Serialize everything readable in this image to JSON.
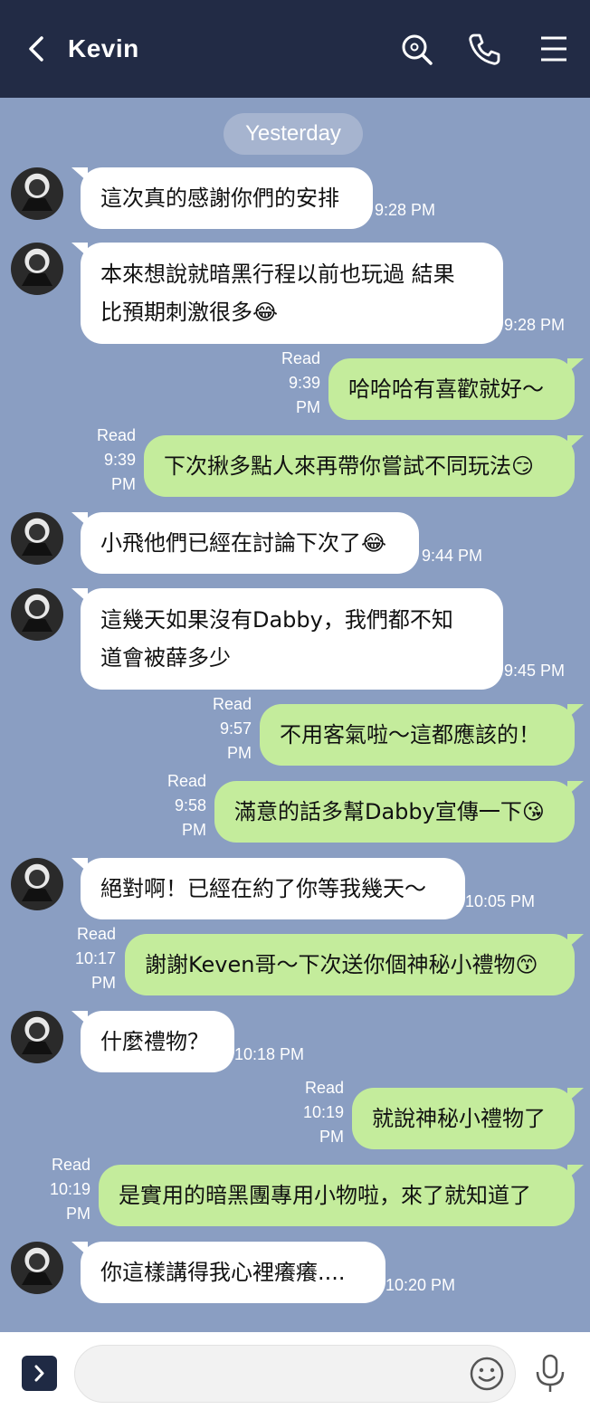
{
  "header": {
    "title": "Kevin"
  },
  "date_separator": "Yesterday",
  "messages": [
    {
      "dir": "in",
      "text": "這次真的感謝你們的安排",
      "time": "9:28 PM"
    },
    {
      "dir": "in",
      "text": "本來想說就暗黑行程以前也玩過 結果\n比預期刺激很多😂",
      "time": "9:28 PM"
    },
    {
      "dir": "out",
      "text": "哈哈哈有喜歡就好～",
      "read": "Read",
      "time_a": "9:39",
      "time_b": "PM"
    },
    {
      "dir": "out",
      "text": "下次揪多點人來再帶你嘗試不同玩法😏",
      "read": "Read",
      "time_a": "9:39",
      "time_b": "PM"
    },
    {
      "dir": "in",
      "text": "小飛他們已經在討論下次了😂",
      "time": "9:44 PM"
    },
    {
      "dir": "in",
      "text": "這幾天如果沒有Dabby，我們都不知\n道會被薛多少",
      "time": "9:45 PM"
    },
    {
      "dir": "out",
      "text": "不用客氣啦～這都應該的！",
      "read": "Read",
      "time_a": "9:57",
      "time_b": "PM"
    },
    {
      "dir": "out",
      "text": "滿意的話多幫Dabby宣傳一下😘",
      "read": "Read",
      "time_a": "9:58",
      "time_b": "PM"
    },
    {
      "dir": "in",
      "text": "絕對啊！已經在約了你等我幾天～",
      "time": "10:05 PM"
    },
    {
      "dir": "out",
      "text": "謝謝Keven哥～下次送你個神秘小禮物😙",
      "read": "Read",
      "time_a": "10:17",
      "time_b": "PM"
    },
    {
      "dir": "in",
      "text": "什麼禮物？",
      "time": "10:18 PM"
    },
    {
      "dir": "out",
      "text": "就說神秘小禮物了",
      "read": "Read",
      "time_a": "10:19",
      "time_b": "PM"
    },
    {
      "dir": "out",
      "text": "是實用的暗黑團專用小物啦，來了就知道了",
      "read": "Read",
      "time_a": "10:19",
      "time_b": "PM"
    },
    {
      "dir": "in",
      "text": "你這樣講得我心裡癢癢....",
      "time": "10:20 PM"
    }
  ],
  "input": {
    "placeholder": ""
  },
  "colors": {
    "header": "#222b45",
    "background": "#8a9ec2",
    "outgoing": "#c4ec9c",
    "incoming": "#ffffff"
  },
  "icons": [
    "back-icon",
    "search-icon",
    "phone-icon",
    "menu-icon",
    "expand-icon",
    "emoji-icon",
    "mic-icon"
  ]
}
